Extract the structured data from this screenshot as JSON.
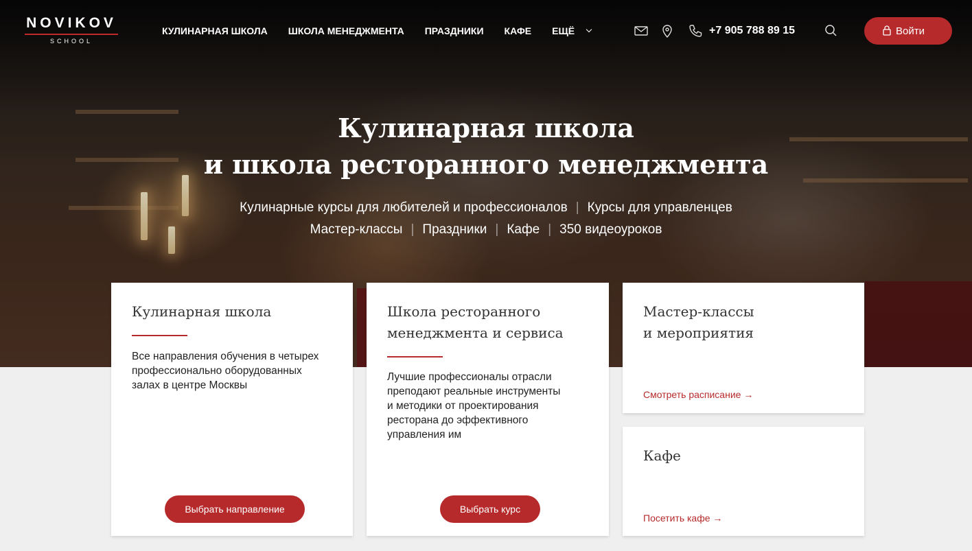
{
  "brand": {
    "name": "NOVIKOV",
    "sub": "SCHOOL"
  },
  "nav": {
    "items": [
      "КУЛИНАРНАЯ ШКОЛА",
      "ШКОЛА МЕНЕДЖМЕНТА",
      "ПРАЗДНИКИ",
      "КАФЕ"
    ],
    "more": "ЕЩЁ"
  },
  "header": {
    "phone": "+7 905 788 89 15",
    "login": "Войти"
  },
  "hero": {
    "title_line1": "Кулинарная школа",
    "title_line2": "и школа ресторанного менеджмента",
    "links_row1": [
      "Кулинарные курсы для любителей и профессионалов",
      "Курсы для управленцев"
    ],
    "links_row2": [
      "Мастер-классы",
      "Праздники",
      "Кафе",
      "350 видеоуроков"
    ],
    "separator": "|"
  },
  "cards": {
    "culinary": {
      "title": "Кулинарная школа",
      "text": [
        "Все направления обучения в четырех",
        "профессионально оборудованных",
        "залах в центре Москвы"
      ],
      "button": "Выбрать направление"
    },
    "management": {
      "title_line1": "Школа ресторанного",
      "title_line2": "менеджмента и сервиса",
      "text": [
        "Лучшие профессионалы отрасли",
        "преподают реальные инструменты",
        "и методики от проектирования",
        "ресторана до эффективного",
        "управления им"
      ],
      "button": "Выбрать курс"
    },
    "masterclass": {
      "title_line1": "Мастер-классы",
      "title_line2": "и мероприятия",
      "link": "Смотреть расписание →"
    },
    "cafe": {
      "title": "Кафе",
      "link": "Посетить кафе →"
    }
  },
  "colors": {
    "accent": "#b62a2b",
    "background": "#efefef",
    "card": "#ffffff"
  }
}
